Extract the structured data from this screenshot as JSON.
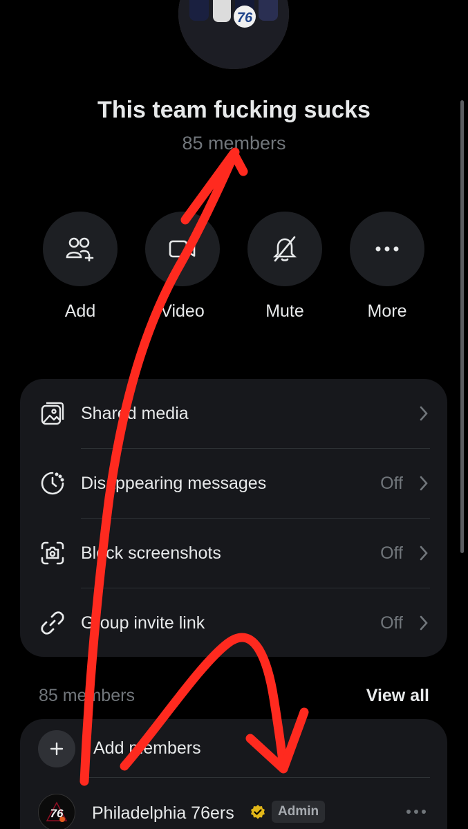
{
  "group": {
    "title": "This team fucking sucks",
    "member_count_label": "85 members"
  },
  "actions": [
    {
      "label": "Add",
      "icon": "add-people-icon"
    },
    {
      "label": "Video",
      "icon": "video-icon"
    },
    {
      "label": "Mute",
      "icon": "bell-off-icon"
    },
    {
      "label": "More",
      "icon": "more-horizontal-icon"
    }
  ],
  "settings": [
    {
      "label": "Shared media",
      "value": "",
      "icon": "media-icon"
    },
    {
      "label": "Disappearing messages",
      "value": "Off",
      "icon": "timer-icon"
    },
    {
      "label": "Block screenshots",
      "value": "Off",
      "icon": "screenshot-icon"
    },
    {
      "label": "Group invite link",
      "value": "Off",
      "icon": "link-icon"
    }
  ],
  "members_section": {
    "header": "85 members",
    "view_all": "View all",
    "add_members": "Add members",
    "members": [
      {
        "name": "Philadelphia 76ers",
        "badge": "Admin",
        "verified": true
      }
    ]
  },
  "colors": {
    "background": "#000000",
    "card": "#17181c",
    "primary_text": "#e7e9ea",
    "secondary_text": "#71767b",
    "annotation": "#ff2a1f",
    "verified_gold": "#e2b719"
  }
}
